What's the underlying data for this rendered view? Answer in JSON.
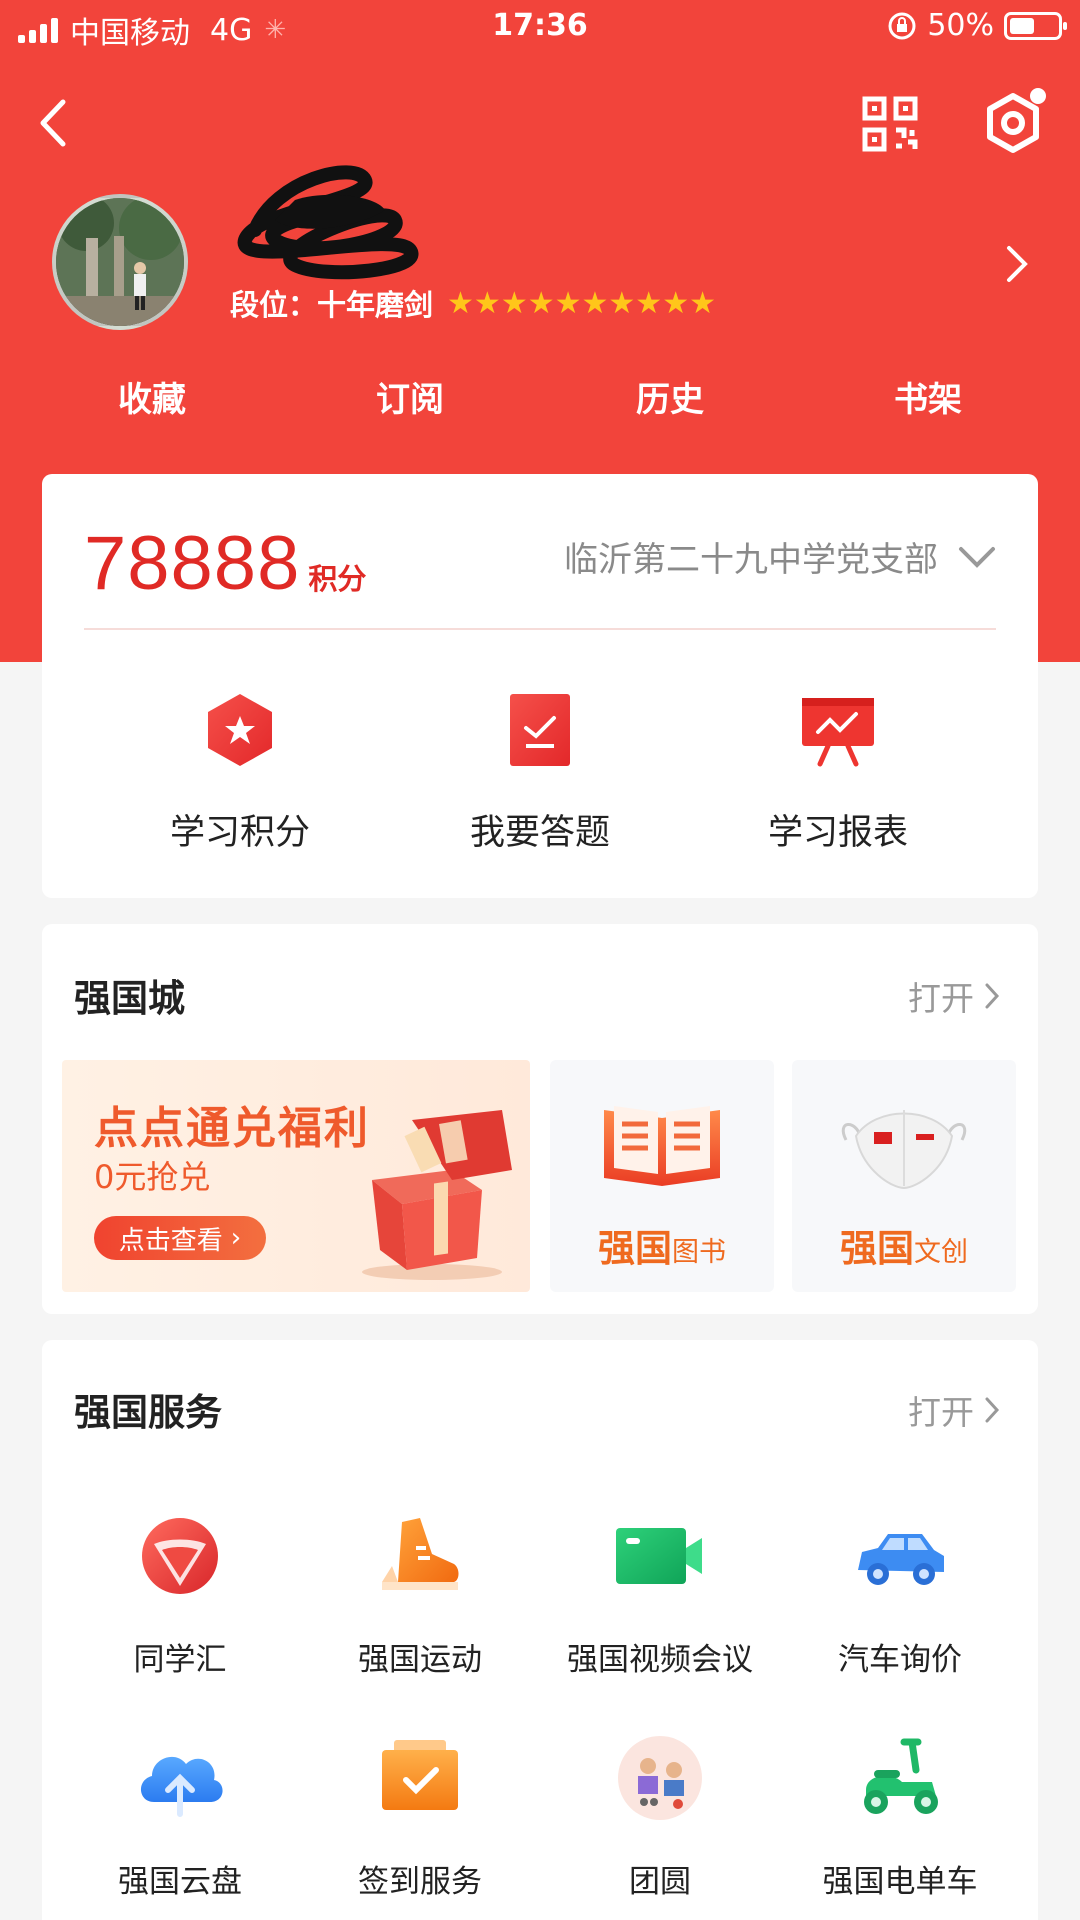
{
  "status_bar": {
    "carrier": "中国移动",
    "network": "4G",
    "time": "17:36",
    "battery": "50%",
    "battery_level": 0.5
  },
  "profile": {
    "rank_label": "段位：",
    "rank_name": "十年磨剑",
    "stars": "★★★★★★★★★★"
  },
  "tabs": [
    "收藏",
    "订阅",
    "历史",
    "书架"
  ],
  "score": {
    "points": "78888",
    "unit": "积分",
    "org": "临沂第二十九中学党支部"
  },
  "features": [
    {
      "label": "学习积分",
      "icon": "points-hexagon-icon"
    },
    {
      "label": "我要答题",
      "icon": "quiz-check-icon"
    },
    {
      "label": "学习报表",
      "icon": "report-board-icon"
    }
  ],
  "mall": {
    "title": "强国城",
    "open": "打开",
    "promo_title": "点点通兑福利",
    "promo_sub": "0元抢兑",
    "promo_button": "点击查看",
    "book_brand": "强国",
    "book_label": "图书",
    "creative_brand": "强国",
    "creative_label": "文创"
  },
  "services": {
    "title": "强国服务",
    "open": "打开",
    "items": [
      {
        "label": "同学汇",
        "icon": "classmates-icon"
      },
      {
        "label": "强国运动",
        "icon": "sport-shoe-icon"
      },
      {
        "label": "强国视频会议",
        "icon": "video-camera-icon"
      },
      {
        "label": "汽车询价",
        "icon": "car-icon"
      },
      {
        "label": "强国云盘",
        "icon": "cloud-upload-icon"
      },
      {
        "label": "签到服务",
        "icon": "checkin-icon"
      },
      {
        "label": "团圆",
        "icon": "reunion-icon"
      },
      {
        "label": "强国电单车",
        "icon": "scooter-icon"
      }
    ]
  },
  "colors": {
    "header_red": "#f2443b",
    "points_red": "#e02a25",
    "brand_orange": "#ef6a1f"
  }
}
